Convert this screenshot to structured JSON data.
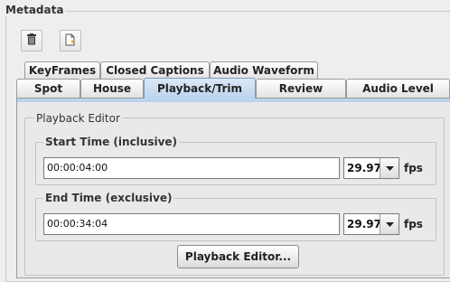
{
  "metadata": {
    "title": "Metadata"
  },
  "toolbar": {
    "delete_icon": "trash-icon",
    "new_icon": "new-document-icon"
  },
  "tabs": {
    "row1": [
      {
        "label": "KeyFrames"
      },
      {
        "label": "Closed Captions"
      },
      {
        "label": "Audio Waveform"
      }
    ],
    "row2": [
      {
        "label": "Spot"
      },
      {
        "label": "House"
      },
      {
        "label": "Playback/Trim",
        "active": true
      },
      {
        "label": "Review"
      },
      {
        "label": "Audio Level"
      }
    ]
  },
  "playback_editor": {
    "title": "Playback Editor",
    "start": {
      "label": "Start Time (inclusive)",
      "value": "00:00:04:00",
      "fps_value": "29.97",
      "fps_unit": "fps"
    },
    "end": {
      "label": "End Time (exclusive)",
      "value": "00:00:34:04",
      "fps_value": "29.97",
      "fps_unit": "fps"
    },
    "button_label": "Playback Editor..."
  },
  "colors": {
    "active_tab": "#bcd3ee",
    "panel_bg": "#e9e9e9"
  }
}
